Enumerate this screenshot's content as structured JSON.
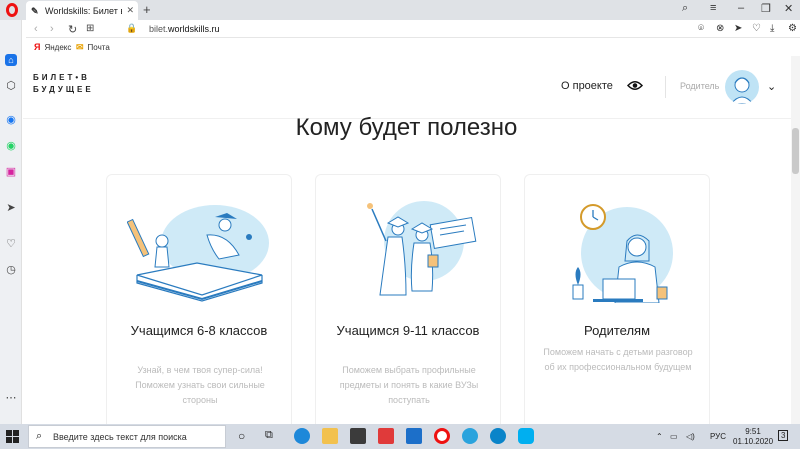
{
  "browser": {
    "tab_title": "Worldskills: Билет в будущ…",
    "url_domain": "bilet.",
    "url_host": "worldskills.ru",
    "bookmarks": [
      {
        "icon": "Я",
        "label": "Яндекс"
      },
      {
        "icon": "✉",
        "label": "Почта"
      }
    ]
  },
  "site": {
    "logo_line1": "БИЛЕТ•В",
    "logo_line2": "БУДУЩЕЕ",
    "nav_about": "О проекте",
    "role_label": "Родитель"
  },
  "main": {
    "heading": "Кому будет полезно",
    "cards": [
      {
        "title": "Учащимся 6-8 классов",
        "desc": "Узнай, в чем твоя супер-сила! Поможем узнать свои сильные стороны"
      },
      {
        "title": "Учащимся 9-11 классов",
        "desc": "Поможем выбрать профильные предметы и понять в какие ВУЗы поступать"
      },
      {
        "title": "Родителям",
        "desc": "Поможем начать с детьми разговор об их профессиональном будущем"
      }
    ]
  },
  "taskbar": {
    "search_placeholder": "Введите здесь текст для поиска",
    "language": "РУС",
    "time": "9:51",
    "date": "01.10.2020",
    "notifications": "3"
  },
  "colors": {
    "accent": "#e11d1d",
    "illustration_blue": "#bfe3f5",
    "line_blue": "#2a7bbf"
  }
}
